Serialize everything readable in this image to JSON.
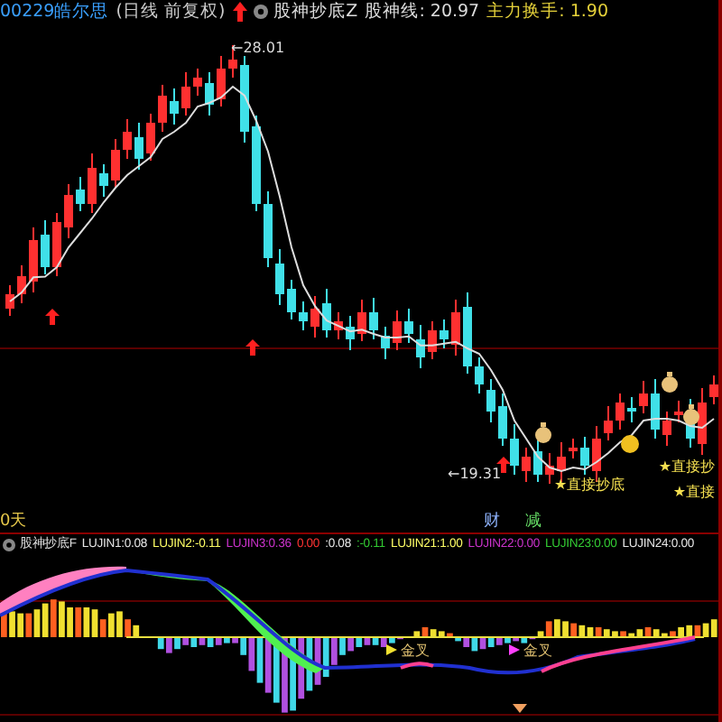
{
  "header": {
    "code": "00229",
    "name": "皓尔思",
    "mode": "(日线 前复权)",
    "indicator": "股神抄底Z",
    "ma_label": "股神线: 20.97",
    "turnover": "主力换手: 1.90"
  },
  "price_labels": {
    "high": "←28.01",
    "low": "←19.31"
  },
  "signals": [
    {
      "text": "★直接抄底"
    },
    {
      "text": "★直接抄"
    },
    {
      "text": "★直接"
    }
  ],
  "time_axis": {
    "left": "0天",
    "marks": [
      {
        "text": "财",
        "color": "#8fb4ff"
      },
      {
        "text": "减",
        "color": "#66dd66"
      }
    ]
  },
  "indicator": {
    "name": "股神抄底F",
    "values": [
      {
        "text": "LUJIN1:0.08",
        "color": "#e6e6e6"
      },
      {
        "text": "LUJIN2:-0.11",
        "color": "#ffff66"
      },
      {
        "text": "LUJIN3:0.36",
        "color": "#cc33cc"
      },
      {
        "text": "0.00",
        "color": "#ff3333"
      },
      {
        "text": ":0.08",
        "color": "#e6e6e6"
      },
      {
        "text": ":-0.11",
        "color": "#33cc33"
      },
      {
        "text": "LUJIN21:1.00",
        "color": "#ffff66"
      },
      {
        "text": "LUJIN22:0.00",
        "color": "#cc33cc"
      },
      {
        "text": "LUJIN23:0.00",
        "color": "#33cc33"
      },
      {
        "text": "LUJIN24:0.00",
        "color": "#e6e6e6"
      }
    ],
    "cross_labels": [
      {
        "text": "金叉"
      },
      {
        "text": "金叉"
      }
    ]
  }
}
